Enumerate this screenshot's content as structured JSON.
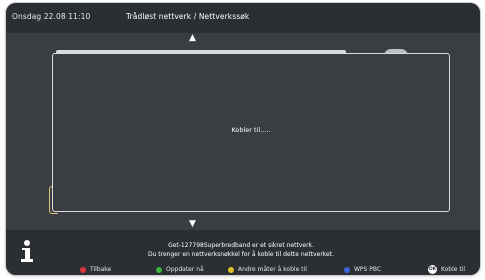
{
  "header": {
    "date_time": "Onsdag 22.08 11:10",
    "title": "Trådløst nettverk / Nettverkssøk"
  },
  "navigation": {
    "up_glyph": "▲",
    "down_glyph": "▼"
  },
  "dialog": {
    "status": "Kobler til....."
  },
  "info": {
    "icon": "info-icon",
    "line1": "Get-127798Superbredband er et sikret nettverk.",
    "line2": "Du trenger en nettverksnøkkel for å koble til dette nettverket."
  },
  "legend": {
    "red": {
      "label": "Tilbake",
      "color": "#d9353a"
    },
    "green": {
      "label": "Oppdater nå",
      "color": "#3fb53c"
    },
    "yellow": {
      "label": "Andre måter å koble til",
      "color": "#e3c22a"
    },
    "blue": {
      "label": "WPS PBC",
      "color": "#3d63d6"
    },
    "ok": {
      "badge": "OK",
      "label": "Koble til"
    }
  },
  "colors": {
    "panel": "#3a3d41",
    "header": "#2b2e32",
    "dialog_border": "#dadcde"
  }
}
